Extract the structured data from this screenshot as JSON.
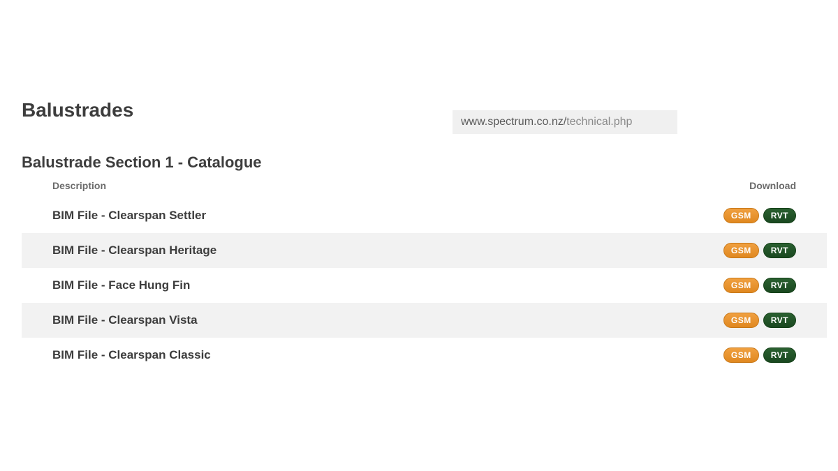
{
  "page_title": "Balustrades",
  "url": {
    "domain": "www.spectrum.co.nz/",
    "path": "technical.php"
  },
  "section_title": "Balustrade Section 1 - Catalogue",
  "table": {
    "header_description": "Description",
    "header_download": "Download",
    "badge_gsm": "GSM",
    "badge_rvt": "RVT",
    "rows": [
      {
        "description": "BIM File - Clearspan Settler"
      },
      {
        "description": "BIM File - Clearspan Heritage"
      },
      {
        "description": "BIM File - Face Hung Fin"
      },
      {
        "description": "BIM File - Clearspan Vista"
      },
      {
        "description": "BIM File - Clearspan Classic"
      }
    ]
  }
}
